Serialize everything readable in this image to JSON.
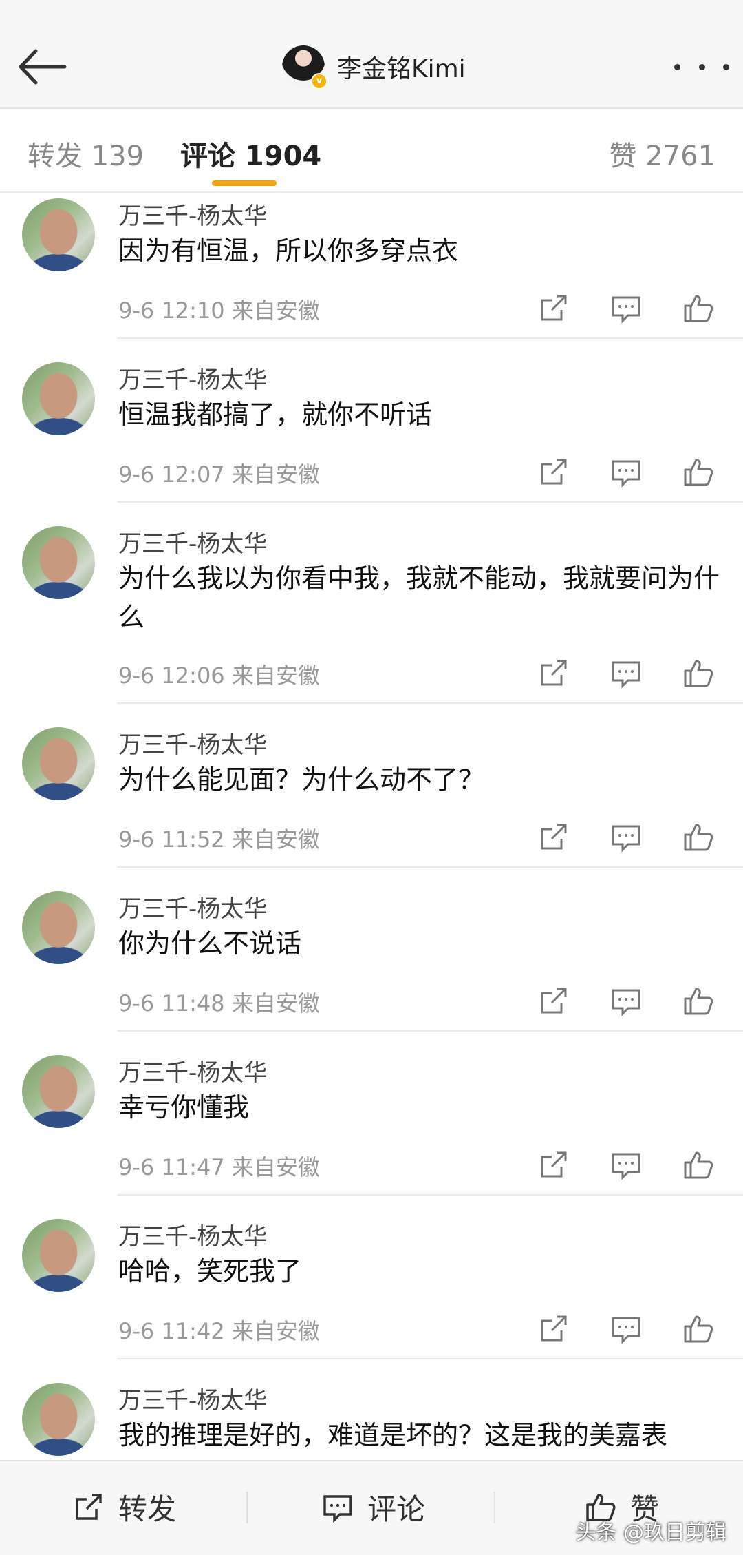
{
  "header": {
    "title": "李金铭Kimi",
    "verified_badge": "v",
    "back_icon": "arrow-left-icon",
    "more_icon": "more-dots-icon"
  },
  "tabs": {
    "repost": "转发 139",
    "comment": "评论 1904",
    "like": "赞 2761",
    "active_color": "#f4a40d"
  },
  "comments": [
    {
      "user": "万三千-杨太华",
      "text": "因为有恒温，所以你多穿点衣",
      "time": "9-6 12:10",
      "source": "来自安徽"
    },
    {
      "user": "万三千-杨太华",
      "text": "恒温我都搞了，就你不听话",
      "time": "9-6 12:07",
      "source": "来自安徽"
    },
    {
      "user": "万三千-杨太华",
      "text": "为什么我以为你看中我，我就不能动，我就要问为什么",
      "time": "9-6 12:06",
      "source": "来自安徽"
    },
    {
      "user": "万三千-杨太华",
      "text": "为什么能见面？为什么动不了？",
      "time": "9-6 11:52",
      "source": "来自安徽"
    },
    {
      "user": "万三千-杨太华",
      "text": "你为什么不说话",
      "time": "9-6 11:48",
      "source": "来自安徽"
    },
    {
      "user": "万三千-杨太华",
      "text": "幸亏你懂我",
      "time": "9-6 11:47",
      "source": "来自安徽"
    },
    {
      "user": "万三千-杨太华",
      "text": "哈哈，笑死我了",
      "time": "9-6 11:42",
      "source": "来自安徽"
    },
    {
      "user": "万三千-杨太华",
      "text": "我的推理是好的，难道是坏的？这是我的美嘉表",
      "time": "",
      "source": ""
    }
  ],
  "bottom_bar": {
    "repost": "转发",
    "comment": "评论",
    "like": "赞"
  },
  "watermark": "头条 @玖日剪辑"
}
